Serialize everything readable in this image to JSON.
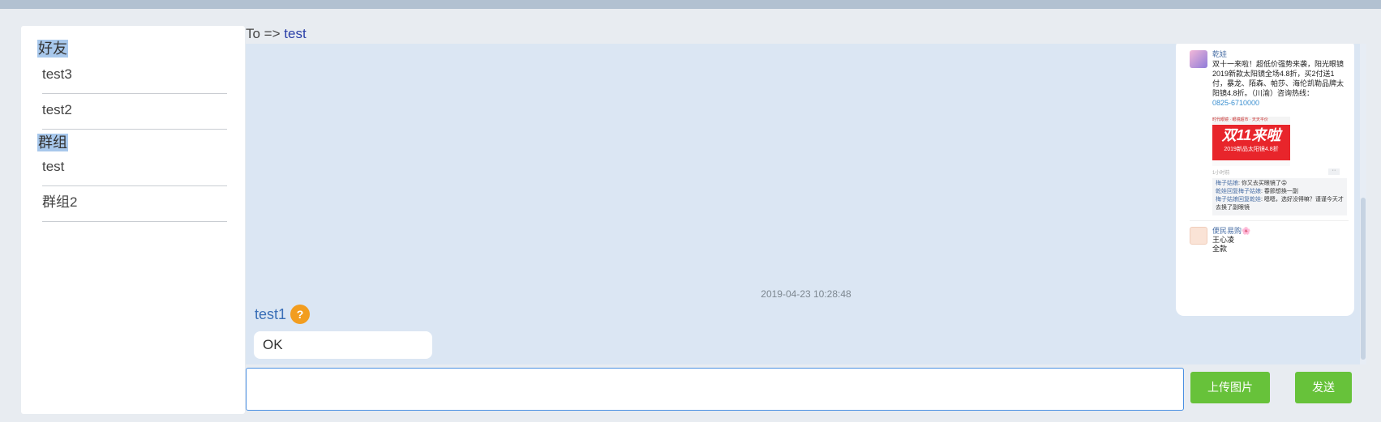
{
  "sidebar": {
    "friends_title": "好友",
    "friends": [
      {
        "label": "test3"
      },
      {
        "label": "test2"
      }
    ],
    "groups_title": "群组",
    "groups": [
      {
        "label": "test"
      },
      {
        "label": "群组2"
      }
    ]
  },
  "header": {
    "prefix": "To =>",
    "recipient": "test"
  },
  "chat": {
    "image_card": {
      "author": "乾娃",
      "post_text": "双十一来啦！超低价强势来袭，阳光眼镜2019新款太阳镜全场4.8折，买2付送1付，暴龙、陌森、帕莎、海伦凯勒品牌太阳镜4.8折。（川渝）咨询热线：",
      "phone": "0825-6710000",
      "promo_bar": "时代眼镜 · 眼镜超市 · 天天平价",
      "promo_big": "双11来啦",
      "promo_small": "2019新品太阳镜4.8折",
      "time": "1小时前",
      "more": "··",
      "comments": [
        {
          "who": "梅子姑娘",
          "text": ": 你又去买眼镜了😜"
        },
        {
          "who": "乾娃回复梅子姑娘",
          "text": ": 春節想換一副"
        },
        {
          "who": "梅子姑娘回复乾娃",
          "text": ": 嗯嗯，选好没得嘛？谨谨今天才去换了副眼镜"
        }
      ],
      "author2": "便民易购🌸",
      "msg2_line1": "王心凌",
      "msg2_line2": "全款"
    },
    "timestamp": "2019-04-23 10:28:48",
    "message": {
      "sender": "test1",
      "avatar_glyph": "?",
      "text": "OK"
    }
  },
  "composer": {
    "input_value": "",
    "upload_label": "上传图片",
    "send_label": "发送"
  },
  "colors": {
    "accent_green": "#67c23a",
    "chat_bg": "#dbe6f3",
    "link_blue": "#3a6fb7"
  }
}
